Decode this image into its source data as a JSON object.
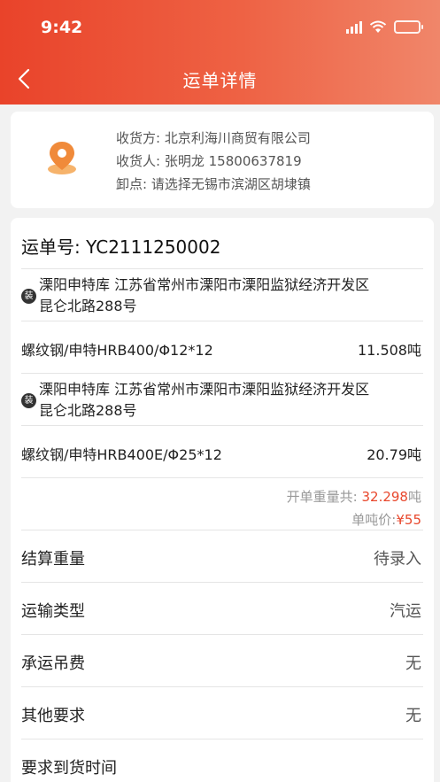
{
  "status_bar": {
    "time": "9:42"
  },
  "nav": {
    "title": "运单详情"
  },
  "receiver": {
    "consignee_label": "收货方:",
    "consignee_value": "北京利海川商贸有限公司",
    "contact_label": "收货人:",
    "contact_name": "张明龙",
    "contact_phone": "15800637819",
    "unload_label": "卸点:",
    "unload_value": "请选择无锡市滨湖区胡埭镇"
  },
  "waybill": {
    "label": "运单号:",
    "number": "YC2111250002",
    "items": [
      {
        "badge": "装",
        "load_line1": "溧阳申特库 江苏省常州市溧阳市溧阳监狱经济开发区",
        "load_line2": "昆仑北路288号",
        "product": "螺纹钢/申特HRB400/Φ12*12",
        "weight": "11.508吨"
      },
      {
        "badge": "装",
        "load_line1": "溧阳申特库 江苏省常州市溧阳市溧阳监狱经济开发区",
        "load_line2": "昆仑北路288号",
        "product": "螺纹钢/申特HRB400E/Φ25*12",
        "weight": "20.79吨"
      }
    ],
    "total_label": "开单重量共:",
    "total_value": "32.298",
    "total_unit": "吨",
    "unit_price_label": "单吨价:",
    "unit_price_value": "¥55"
  },
  "details": [
    {
      "label": "结算重量",
      "value": "待录入"
    },
    {
      "label": "运输类型",
      "value": "汽运"
    },
    {
      "label": "承运吊费",
      "value": "无"
    },
    {
      "label": "其他要求",
      "value": "无"
    },
    {
      "label": "要求到货时间",
      "value": ""
    }
  ],
  "colors": {
    "accent": "#e8472c",
    "header_start": "#e9432a",
    "header_end": "#f0866a"
  }
}
